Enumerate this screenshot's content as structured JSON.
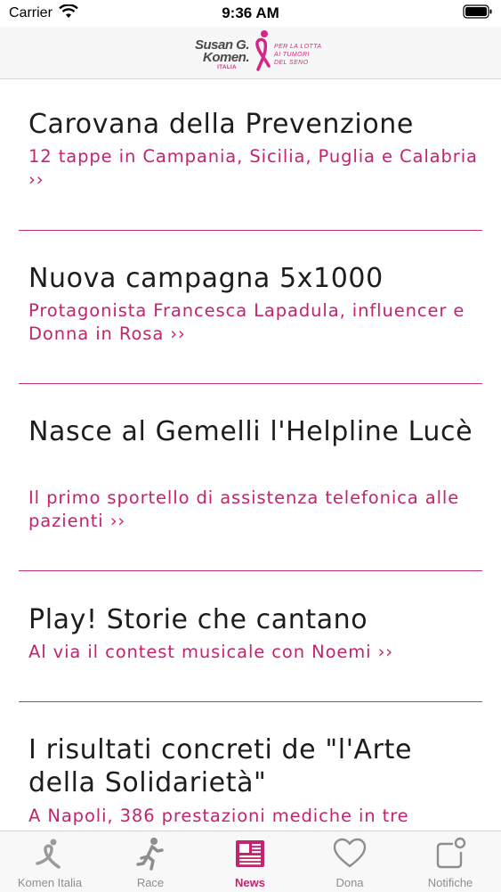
{
  "status_bar": {
    "carrier": "Carrier",
    "time": "9:36 AM"
  },
  "header": {
    "brand": "Susan G. Komen.",
    "country": "ITALIA",
    "tagline": "PER LA LOTTA\nAI TUMORI\nDEL SENO"
  },
  "news": [
    {
      "title": "Carovana della Prevenzione",
      "subtitle": "12 tappe in Campania, Sicilia, Puglia e Calabria ››"
    },
    {
      "title": "Nuova campagna 5x1000",
      "subtitle": "Protagonista Francesca Lapadula, influencer e Donna in Rosa ››"
    },
    {
      "title": "Nasce al Gemelli l'Helpline Lucè",
      "subtitle": "Il primo sportello di assistenza telefonica alle pazienti ››"
    },
    {
      "title": "Play! Storie che cantano",
      "subtitle": "Al via il contest musicale con Noemi ››"
    },
    {
      "title": "I risultati concreti de \"l'Arte della Solidarietà\"",
      "subtitle": "A Napoli, 386 prestazioni mediche in tre"
    }
  ],
  "tabs": [
    {
      "label": "Komen Italia",
      "icon": "ribbon-runner-icon",
      "active": false
    },
    {
      "label": "Race",
      "icon": "runner-icon",
      "active": false
    },
    {
      "label": "News",
      "icon": "newspaper-icon",
      "active": true
    },
    {
      "label": "Dona",
      "icon": "heart-icon",
      "active": false
    },
    {
      "label": "Notifiche",
      "icon": "notification-icon",
      "active": false
    }
  ],
  "colors": {
    "accent": "#c2246f",
    "divider": "#c3306f",
    "inactive_tab": "#8e8e8e"
  }
}
